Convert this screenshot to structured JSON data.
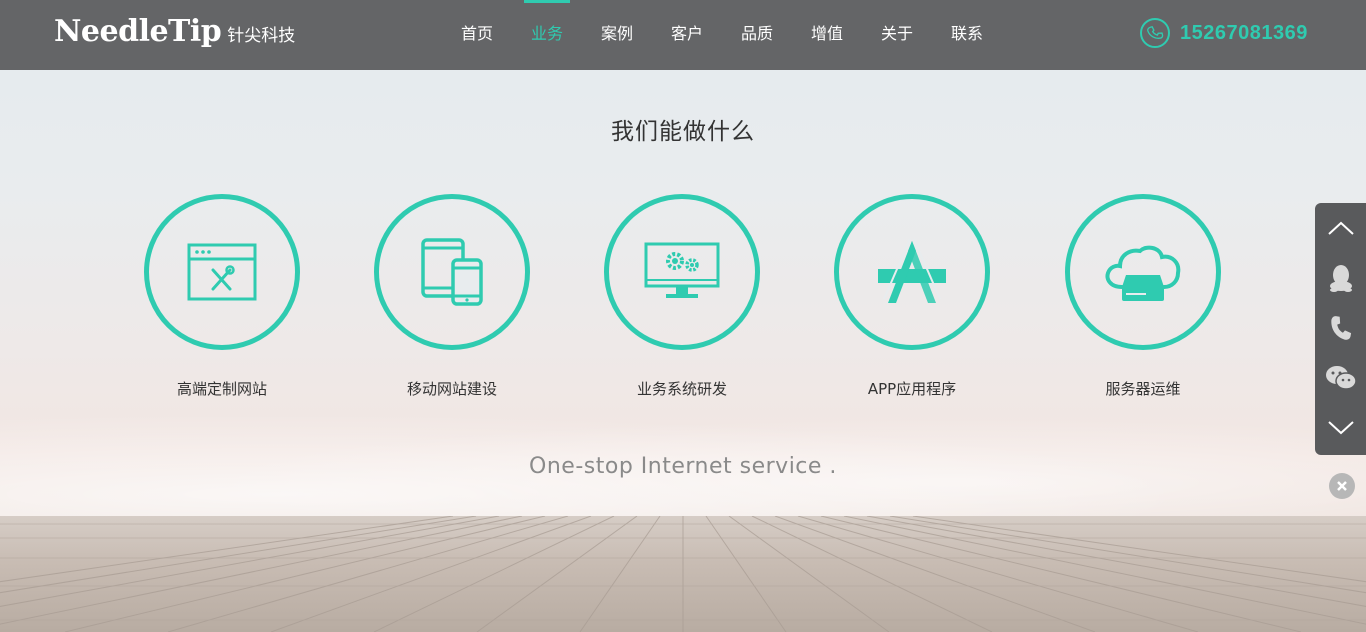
{
  "brand": {
    "name_en": "NeedleTip",
    "name_cn": "针尖科技"
  },
  "nav": {
    "items": [
      {
        "label": "首页",
        "active": false
      },
      {
        "label": "业务",
        "active": true
      },
      {
        "label": "案例",
        "active": false
      },
      {
        "label": "客户",
        "active": false
      },
      {
        "label": "品质",
        "active": false
      },
      {
        "label": "增值",
        "active": false
      },
      {
        "label": "关于",
        "active": false
      },
      {
        "label": "联系",
        "active": false
      }
    ]
  },
  "contact": {
    "phone": "15267081369",
    "icon": "phone-icon"
  },
  "main": {
    "title": "我们能做什么",
    "services": [
      {
        "label": "高端定制网站",
        "icon": "browser-tools-icon"
      },
      {
        "label": "移动网站建设",
        "icon": "tablet-phone-icon"
      },
      {
        "label": "业务系统研发",
        "icon": "monitor-gears-icon"
      },
      {
        "label": "APP应用程序",
        "icon": "app-store-icon"
      },
      {
        "label": "服务器运维",
        "icon": "cloud-server-icon"
      }
    ],
    "tagline": "One-stop Internet service ."
  },
  "sidebar": {
    "buttons": [
      "chevron-up-icon",
      "qq-icon",
      "phone-icon",
      "wechat-icon",
      "chevron-down-icon"
    ],
    "close_icon": "close-icon"
  },
  "colors": {
    "accent": "#2fcbb0",
    "header_bg": "#646567",
    "sidebar_bg": "#595a5c"
  }
}
